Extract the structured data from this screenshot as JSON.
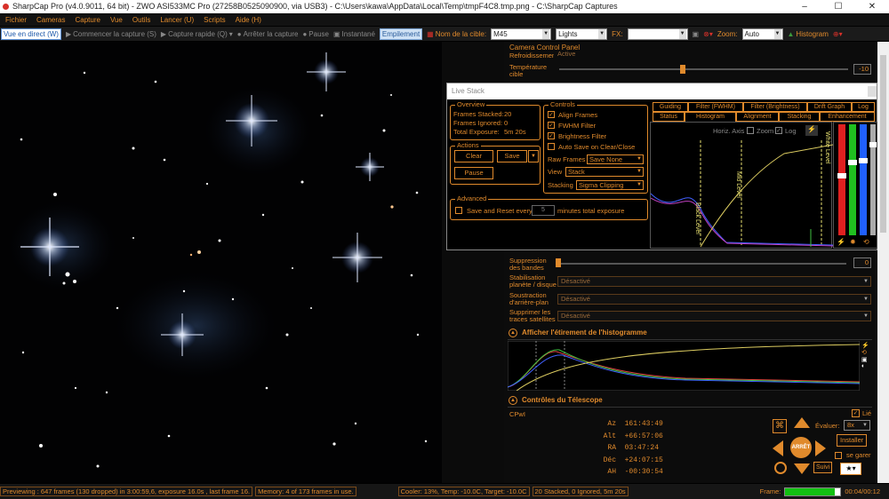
{
  "window": {
    "title": "SharpCap Pro (v4.0.9011, 64 bit) - ZWO ASI533MC Pro (27258B0525090900, via USB3) - C:\\Users\\kawa\\AppData\\Local\\Temp\\tmpF4C8.tmp.png - C:\\SharpCap Captures",
    "minimize": "–",
    "maximize": "☐",
    "close": "✕"
  },
  "menu": [
    "Fichier",
    "Cameras",
    "Capture",
    "Vue",
    "Outils",
    "Lancer (U)",
    "Scripts",
    "Aide (H)"
  ],
  "toolbar": {
    "live": "Vue en direct (W)",
    "start_capture": "Commencer la capture (S)",
    "quick_capture": "Capture rapide (Q)",
    "stop_capture": "Arrêter la capture",
    "pause": "Pause",
    "snapshot": "Instantané",
    "stacking": "Empilement",
    "target_label": "Nom de la cible:",
    "target_value": "M45",
    "frame_type": "Lights",
    "fx_label": "FX:",
    "fx_value": "",
    "zoom_label": "Zoom:",
    "zoom_value": "Auto",
    "histogram": "Histogram"
  },
  "camera_panel": {
    "title": "Camera Control Panel",
    "rows": [
      {
        "label": "Refroidissement",
        "value": "Active"
      },
      {
        "label": "Température cible",
        "value": "-10"
      }
    ],
    "banding_label": "Suppression des bandes",
    "banding_value": "0",
    "stab_label": "Stabilisation planète / disque",
    "stab_value": "Désactivé",
    "bg_label": "Soustraction d'arrière-plan",
    "bg_value": "Désactivé",
    "sat_label": "Supprimer les traces satellites",
    "sat_value": "Désactivé",
    "histo_section": "Afficher l'étirement de l'histogramme",
    "tele_section": "Contrôles du Télescope",
    "tele_mount": "CPwI",
    "tele_rows": [
      {
        "k": "Az",
        "v": "161:43:49"
      },
      {
        "k": "Alt",
        "v": "+66:57:06"
      },
      {
        "k": "RA",
        "v": "03:47:24"
      },
      {
        "k": "Déc",
        "v": "+24:07:15"
      },
      {
        "k": "AH",
        "v": "-00:30:54"
      }
    ],
    "tele_lie": "Lié",
    "tele_eval_label": "Évaluer:",
    "tele_eval_value": "8x",
    "tele_install": "Installer",
    "tele_park": "se garer",
    "tele_center": "ARRÊT",
    "tele_follow": "Suivi"
  },
  "live_stack": {
    "title": "Live Stack",
    "overview_title": "Overview",
    "frames_stacked_label": "Frames Stacked:",
    "frames_stacked": "20",
    "frames_ignored_label": "Frames Ignored:",
    "frames_ignored": "0",
    "total_exposure_label": "Total Exposure:",
    "total_exposure": "5m 20s",
    "actions_title": "Actions",
    "clear": "Clear",
    "save": "Save",
    "pause": "Pause",
    "advanced_title": "Advanced",
    "save_reset_label": "Save and Reset every",
    "save_reset_value": "5",
    "save_reset_suffix": "minutes total exposure",
    "controls_title": "Controls",
    "align_frames": "Align Frames",
    "fwhm_filter": "FWHM Filter",
    "brightness_filter": "Brightness Filter",
    "auto_save": "Auto Save on Clear/Close",
    "raw_frames_label": "Raw Frames",
    "raw_frames_value": "Save None",
    "view_label": "View",
    "view_value": "Stack",
    "stacking_label": "Stacking",
    "stacking_value": "Sigma Clipping",
    "tabs_row1": [
      "Guiding",
      "Filter (FWHM)",
      "Filter (Brightness)",
      "Drift Graph",
      "Log"
    ],
    "tabs_row2": [
      "Status",
      "Histogram",
      "Alignment",
      "Stacking",
      "Enhancement"
    ],
    "horiz_label": "Horiz. Axis",
    "zoom_label": "Zoom",
    "log_label": "Log",
    "black_level": "Black Level",
    "mid_level": "Mid Level",
    "white_level": "White Level"
  },
  "status": {
    "previewing": "Previewing : 647 frames (130 dropped) in 3:00:59,6, exposure 16.0s , last frame 16.",
    "memory": "Memory: 4 of 173 frames in use.",
    "cooler": "Cooler: 13%, Temp: -10.0C, Target: -10.0C",
    "stack": "20 Stacked, 0 Ignored, 5m 20s",
    "frame_label": "Frame:",
    "frame_progress": 0.9,
    "time": "00:04/00:12"
  }
}
